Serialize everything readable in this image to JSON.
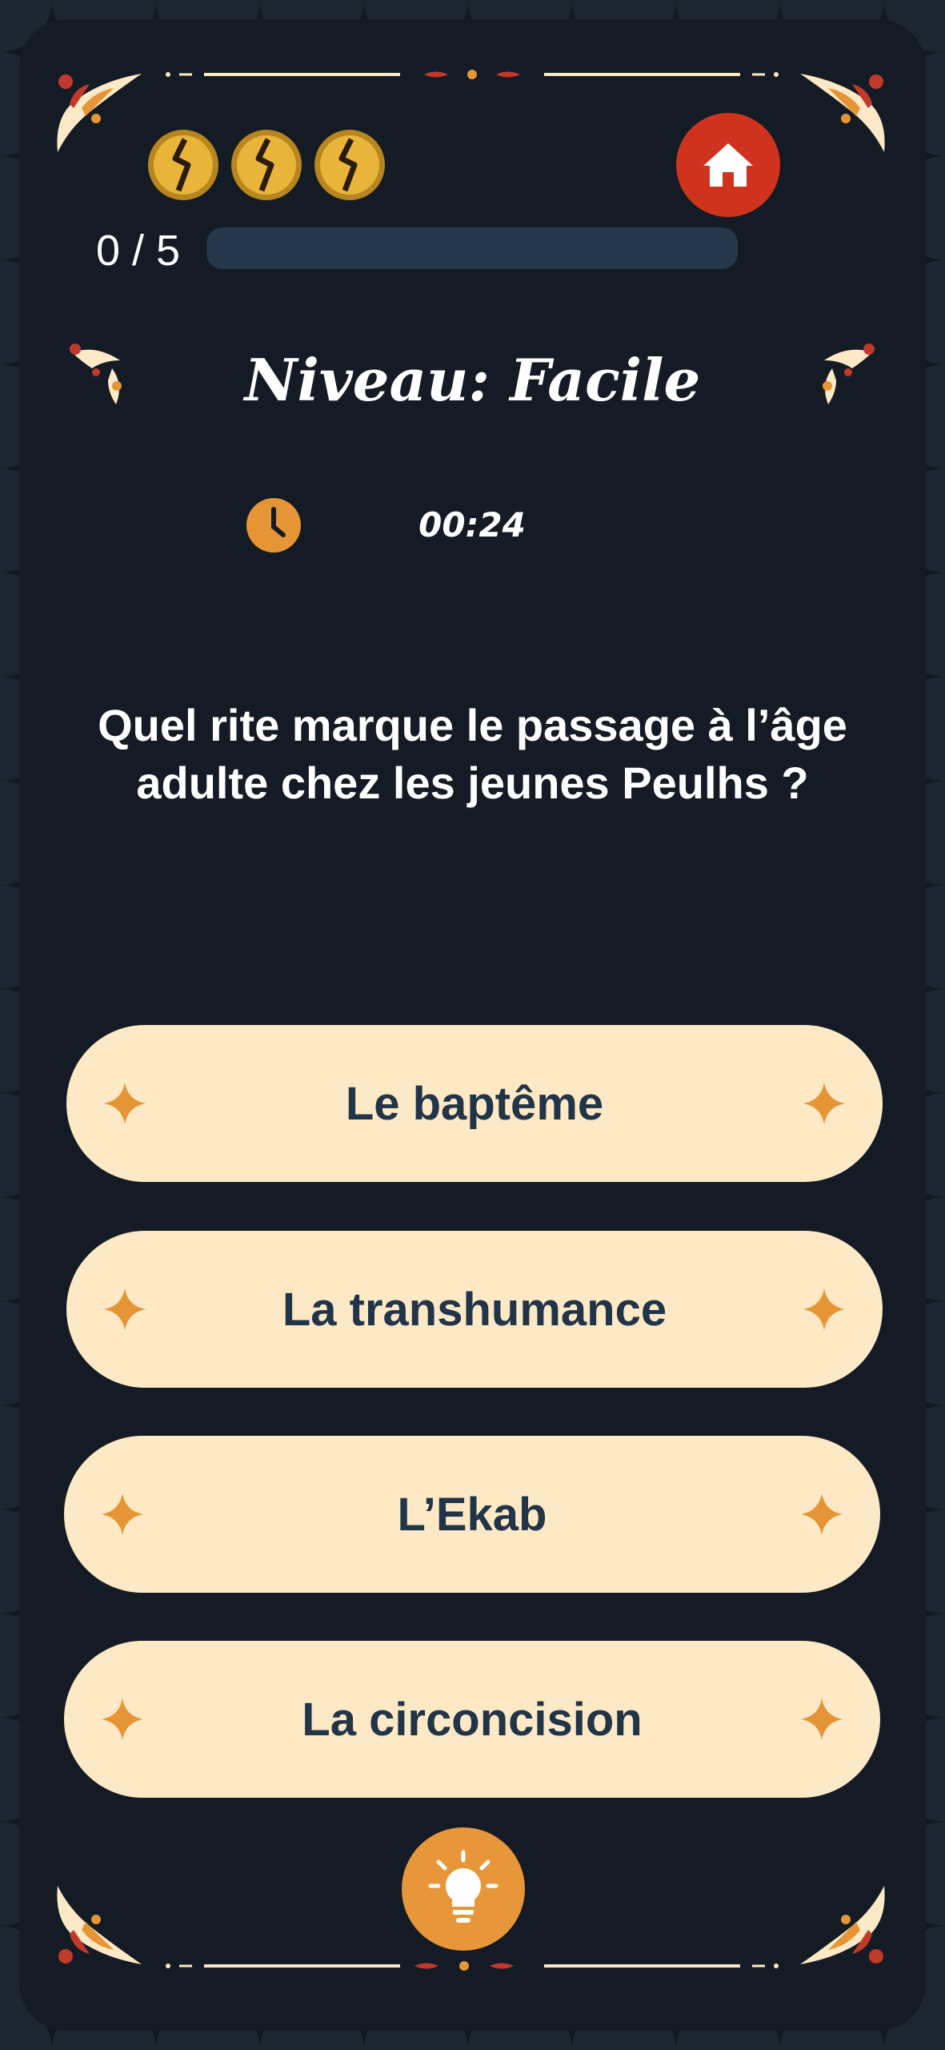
{
  "lives": {
    "count": 3,
    "icon": "cracked-coin-icon",
    "color": "#e0a52a"
  },
  "home_button": {
    "icon": "home-icon",
    "color": "#d0331d"
  },
  "progress": {
    "label": "0 / 5",
    "answered": 0,
    "total": 5,
    "fraction": 0
  },
  "level": {
    "title": "Niveau: Facile"
  },
  "timer": {
    "icon": "clock-icon",
    "value": "00:24"
  },
  "question": {
    "text": "Quel rite marque le passage à l’âge adulte chez les jeunes Peulhs ?"
  },
  "answers": [
    {
      "label": "Le baptême"
    },
    {
      "label": "La transhumance"
    },
    {
      "label": "L’Ekab"
    },
    {
      "label": "La circoncision"
    }
  ],
  "hint_button": {
    "icon": "lightbulb-icon",
    "color": "#e7963a"
  },
  "theme": {
    "background": "#141b24",
    "accent": "#e59536",
    "answer_background": "#fde9c6",
    "answer_text": "#213448"
  }
}
